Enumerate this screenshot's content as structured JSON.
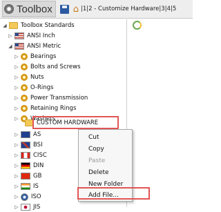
{
  "toolbar": {
    "logo": "Toolbox",
    "tabs": [
      "1",
      "2 - Customize Hardware",
      "3",
      "4",
      "5"
    ]
  },
  "tree": {
    "root": "Toolbox Standards",
    "ansi_inch": "ANSI Inch",
    "ansi_metric": "ANSI Metric",
    "children": [
      "Bearings",
      "Bolts and Screws",
      "Nuts",
      "O-Rings",
      "Power Transmission",
      "Retaining Rings",
      "Washers"
    ],
    "custom": "CUSTOM HARDWARE",
    "standards": [
      "AS",
      "BSI",
      "CISC",
      "DIN",
      "GB",
      "IS",
      "ISO",
      "JIS"
    ]
  },
  "context_menu": {
    "items": [
      "Cut",
      "Copy",
      "Paste",
      "Delete",
      "New Folder",
      "Add File..."
    ],
    "disabled": [
      "Paste"
    ]
  },
  "colors": {
    "highlight": "#e25555",
    "folder": "#f3c957",
    "toolbar_bg": "#eeeeee"
  },
  "icons": {
    "save": "save-icon",
    "home": "home-icon",
    "refresh": "refresh-icon",
    "gear": "gear-icon"
  }
}
